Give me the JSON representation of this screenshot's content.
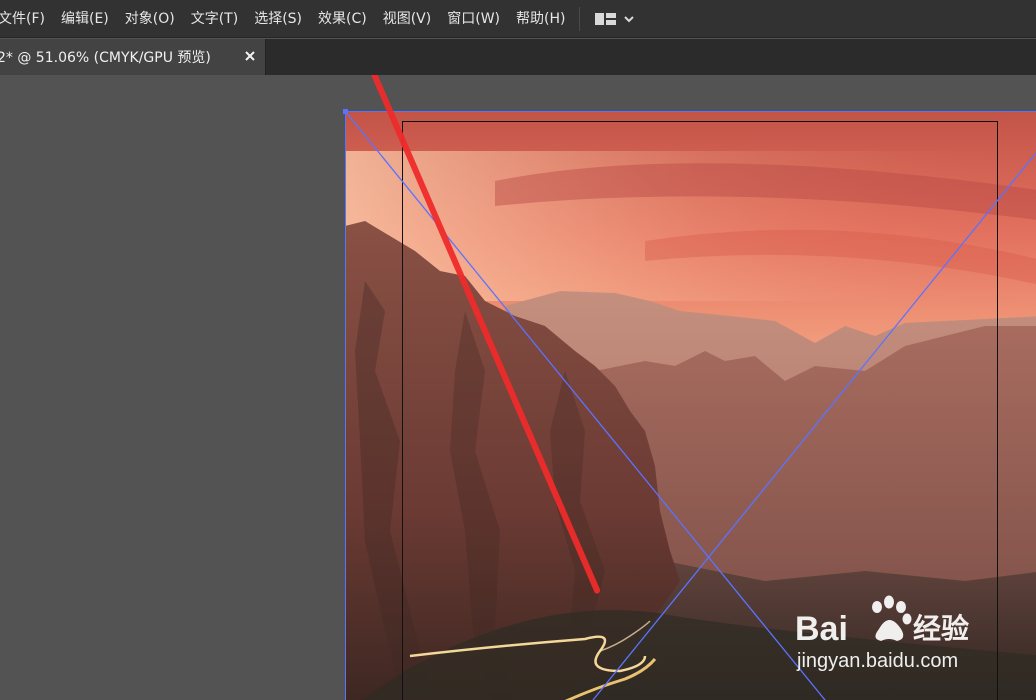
{
  "menu": {
    "items": [
      {
        "key": "file",
        "label": "文件(F)"
      },
      {
        "key": "edit",
        "label": "编辑(E)"
      },
      {
        "key": "object",
        "label": "对象(O)"
      },
      {
        "key": "type",
        "label": "文字(T)"
      },
      {
        "key": "select",
        "label": "选择(S)"
      },
      {
        "key": "effect",
        "label": "效果(C)"
      },
      {
        "key": "view",
        "label": "视图(V)"
      },
      {
        "key": "window",
        "label": "窗口(W)"
      },
      {
        "key": "help",
        "label": "帮助(H)"
      }
    ]
  },
  "tab": {
    "title": "2* @ 51.06% (CMYK/GPU 预览)",
    "close_symbol": "×"
  },
  "watermark": {
    "brand": "Bai",
    "brand_suffix": "经验",
    "url": "jingyan.baidu.com"
  },
  "icons": {
    "workspace": "workspace-layout-icon",
    "dropdown": "chevron-down-icon",
    "close": "close-icon",
    "paw": "baidu-paw-icon"
  },
  "colors": {
    "menubar_bg": "#323232",
    "canvas_bg": "#535353",
    "selection": "#5b73ff",
    "annotation_arrow": "#ee2b2b"
  }
}
